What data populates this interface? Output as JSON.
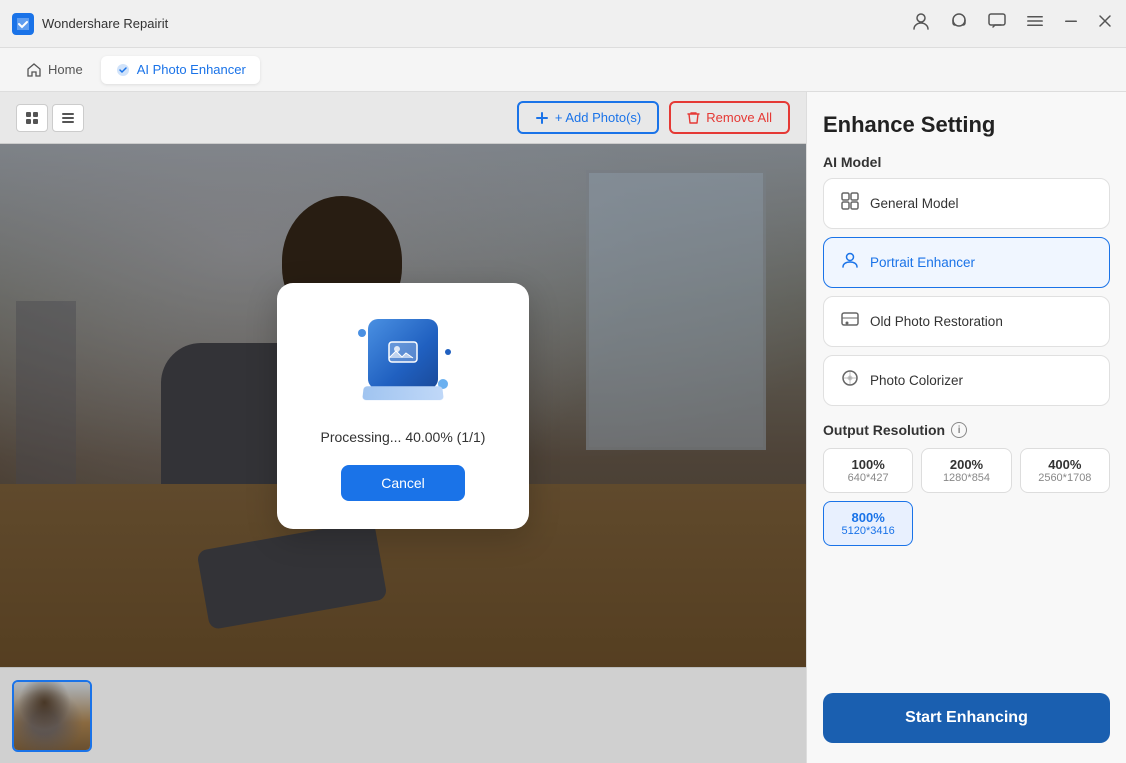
{
  "titleBar": {
    "appName": "Wondershare Repairit",
    "icon": "WR"
  },
  "navBar": {
    "homeTab": "Home",
    "activeTab": "AI Photo Enhancer"
  },
  "toolbar": {
    "addPhotos": "+ Add Photo(s)",
    "removeAll": "Remove All"
  },
  "modal": {
    "processingText": "Processing... 40.00% (1/1)",
    "cancelButton": "Cancel"
  },
  "rightPanel": {
    "title": "Enhance Setting",
    "aiModelLabel": "AI Model",
    "models": [
      {
        "id": "general",
        "label": "General Model",
        "selected": false
      },
      {
        "id": "portrait",
        "label": "Portrait Enhancer",
        "selected": true
      },
      {
        "id": "oldphoto",
        "label": "Old Photo Restoration",
        "selected": false
      },
      {
        "id": "colorizer",
        "label": "Photo Colorizer",
        "selected": false
      }
    ],
    "outputResolutionLabel": "Output Resolution",
    "resolutions": [
      {
        "id": "100",
        "percent": "100%",
        "dim": "640*427",
        "selected": false
      },
      {
        "id": "200",
        "percent": "200%",
        "dim": "1280*854",
        "selected": false
      },
      {
        "id": "400",
        "percent": "400%",
        "dim": "2560*1708",
        "selected": false
      },
      {
        "id": "800",
        "percent": "800%",
        "dim": "5120*3416",
        "selected": true
      }
    ],
    "startButton": "Start Enhancing"
  }
}
